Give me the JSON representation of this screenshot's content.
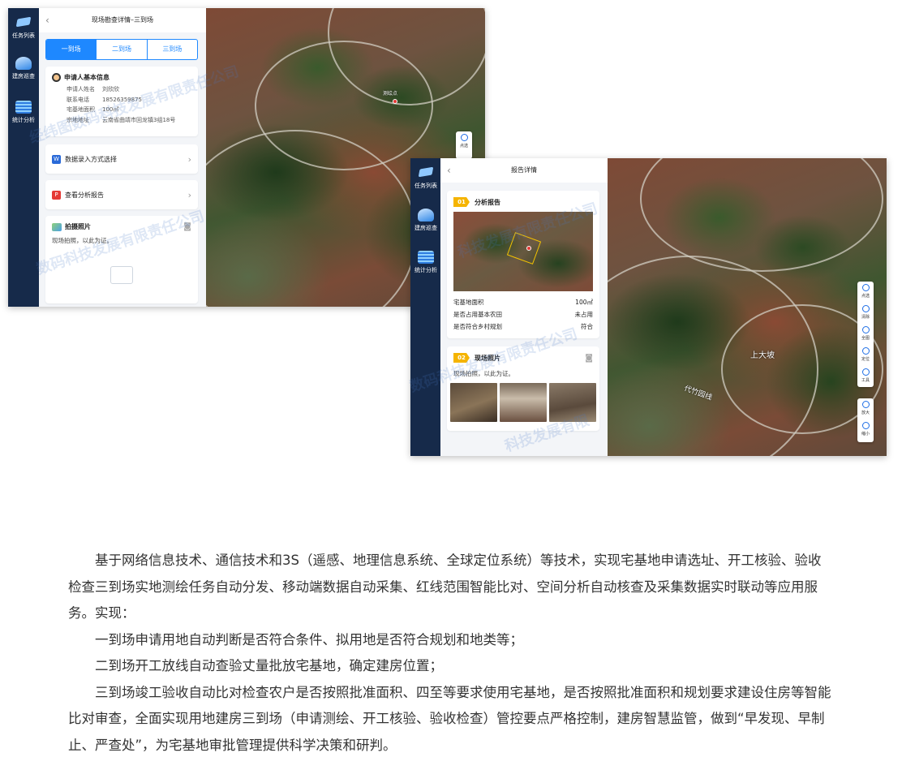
{
  "screen1": {
    "nav": [
      {
        "label": "任务列表",
        "icon": "tasks-icon"
      },
      {
        "label": "建房巡查",
        "icon": "house-icon"
      },
      {
        "label": "统计分析",
        "icon": "stats-icon"
      }
    ],
    "title": "现场勘查详情–三到场",
    "tabs": [
      "一到场",
      "二到场",
      "三到场"
    ],
    "applicant": {
      "heading": "申请人基本信息",
      "fields": [
        {
          "k": "申请人姓名",
          "v": "刘欣欣"
        },
        {
          "k": "联系电话",
          "v": "18526359875"
        },
        {
          "k": "宅基地面积",
          "v": "100㎡"
        },
        {
          "k": "宗地地址",
          "v": "云南省曲靖市回龙镇3组18号"
        }
      ]
    },
    "data_entry": "数据录入方式选择",
    "view_report": "查看分析报告",
    "photo": {
      "heading": "拍摄照片",
      "note": "现场拍照，以此为证。"
    },
    "map_pin_label": "测绘点",
    "toolbar": [
      "点选"
    ]
  },
  "screen2": {
    "nav": [
      {
        "label": "任务列表",
        "icon": "tasks-icon"
      },
      {
        "label": "建房巡查",
        "icon": "house-icon"
      },
      {
        "label": "统计分析",
        "icon": "stats-icon"
      }
    ],
    "title": "报告详情",
    "report": {
      "num": "01",
      "heading": "分析报告",
      "rows": [
        {
          "k": "宅基地面积",
          "v": "100㎡"
        },
        {
          "k": "是否占用基本农田",
          "v": "未占用"
        },
        {
          "k": "是否符合乡村规划",
          "v": "符合"
        }
      ]
    },
    "photos": {
      "num": "02",
      "heading": "现场照片",
      "note": "现场拍照，以此为证。"
    },
    "place": "上大坡",
    "map_road": "代竹园线",
    "toolbar": [
      "点选",
      "清除",
      "全图",
      "定位",
      "工具",
      "放大",
      "缩小"
    ]
  },
  "watermarks": [
    "经纬图数码科技发展有限责任公司",
    "数码科技发展有限责任公司",
    "科技发展有限责任公司",
    "数码科技发展有限责任公司",
    "科技发展有限"
  ],
  "body": {
    "p1": "基于网络信息技术、通信技术和3S（遥感、地理信息系统、全球定位系统）等技术，实现宅基地申请选址、开工核验、验收检查三到场实地测绘任务自动分发、移动端数据自动采集、红线范围智能比对、空间分析自动核查及采集数据实时联动等应用服务。实现：",
    "p2": "一到场申请用地自动判断是否符合条件、拟用地是否符合规划和地类等；",
    "p3": "二到场开工放线自动查验丈量批放宅基地，确定建房位置；",
    "p4": "三到场竣工验收自动比对检查农户是否按照批准面积、四至等要求使用宅基地，是否按照批准面积和规划要求建设住房等智能比对审查，全面实现用地建房三到场（申请测绘、开工核验、验收检查）管控要点严格控制，建房智慧监管，做到“早发现、早制止、严查处”，为宅基地审批管理提供科学决策和研判。"
  }
}
